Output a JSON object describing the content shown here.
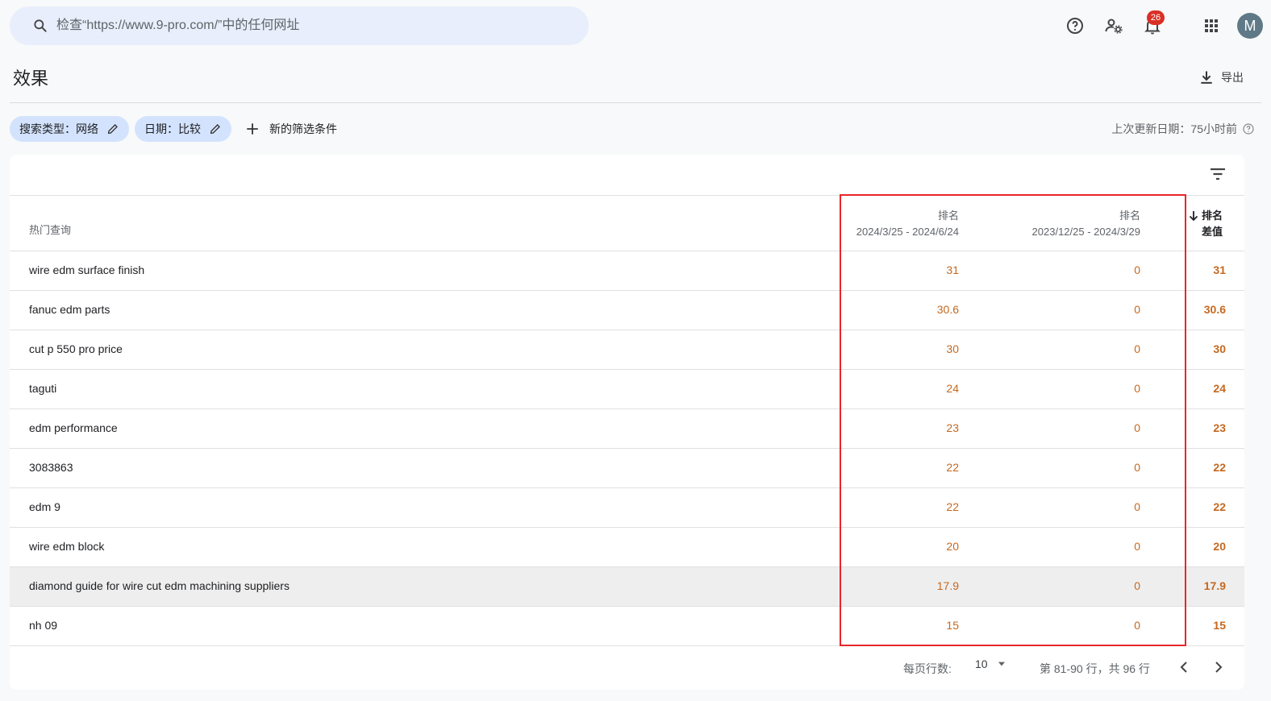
{
  "search": {
    "placeholder": "检查“https://www.9-pro.com/”中的任何网址"
  },
  "topbar": {
    "notification_count": "26",
    "avatar_letter": "M"
  },
  "page": {
    "title": "效果",
    "export_label": "导出"
  },
  "filters": {
    "chips": [
      "搜索类型：网络",
      "日期：比较"
    ],
    "new_filter_label": "新的筛选条件",
    "last_updated": "上次更新日期：75小时前"
  },
  "table": {
    "headers": {
      "query": "热门查询",
      "col1_title": "排名",
      "col1_range": "2024/3/25 - 2024/6/24",
      "col2_title": "排名",
      "col2_range": "2023/12/25 - 2024/3/29",
      "diff_line1": "排名",
      "diff_line2": "差值"
    },
    "rows": [
      {
        "query": "wire edm surface finish",
        "v1": "31",
        "v2": "0",
        "diff": "31"
      },
      {
        "query": "fanuc edm parts",
        "v1": "30.6",
        "v2": "0",
        "diff": "30.6"
      },
      {
        "query": "cut p 550 pro price",
        "v1": "30",
        "v2": "0",
        "diff": "30"
      },
      {
        "query": "taguti",
        "v1": "24",
        "v2": "0",
        "diff": "24"
      },
      {
        "query": "edm performance",
        "v1": "23",
        "v2": "0",
        "diff": "23"
      },
      {
        "query": "3083863",
        "v1": "22",
        "v2": "0",
        "diff": "22"
      },
      {
        "query": "edm 9",
        "v1": "22",
        "v2": "0",
        "diff": "22"
      },
      {
        "query": "wire edm block",
        "v1": "20",
        "v2": "0",
        "diff": "20"
      },
      {
        "query": "diamond guide for wire cut edm machining suppliers",
        "v1": "17.9",
        "v2": "0",
        "diff": "17.9"
      },
      {
        "query": "nh 09",
        "v1": "15",
        "v2": "0",
        "diff": "15"
      }
    ]
  },
  "pagination": {
    "rows_per_page_label": "每页行数:",
    "rows_per_page_value": "10",
    "range_text": "第 81-90 行，共 96 行"
  },
  "colors": {
    "accent_value": "#c5681f",
    "highlight_box": "#e8262b",
    "chip_bg": "#d3e3fd"
  }
}
